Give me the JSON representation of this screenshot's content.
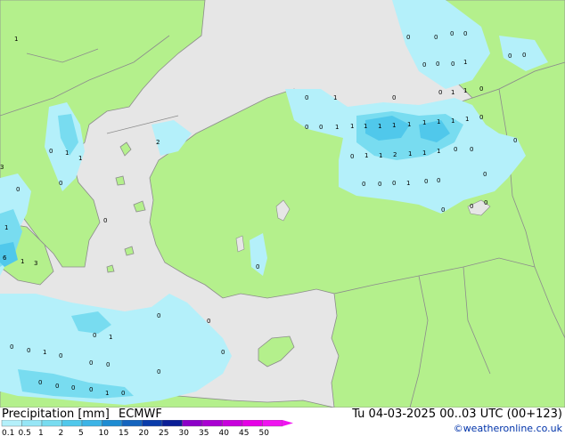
{
  "header": {
    "title": "Precipitation [mm]",
    "model": "ECMWF",
    "datetime": "Tu 04-03-2025 00..03 UTC (00+123)",
    "credit": "©weatheronline.co.uk"
  },
  "legend": {
    "ticks": [
      "0.1",
      "0.5",
      "1",
      "2",
      "5",
      "10",
      "15",
      "20",
      "25",
      "30",
      "35",
      "40",
      "45",
      "50"
    ],
    "colors": [
      "#b4f0fa",
      "#96e6f6",
      "#78dcf0",
      "#50c8eb",
      "#3cb4e6",
      "#1e8cd2",
      "#1464be",
      "#0a3caa",
      "#0a1e96",
      "#8c00c8",
      "#aa00d2",
      "#c800dc",
      "#e600e6",
      "#f014f0"
    ]
  },
  "map_colors": {
    "land": "#b4f08c",
    "sea": "#e6e6e6",
    "coast": "#8c8c8c",
    "border": "#8c8c8c",
    "precip_light": "#b4f0fa",
    "precip_mid": "#78dcf0",
    "precip_strong": "#50c8eb"
  },
  "station_values": [
    "0",
    "1",
    "2",
    "3",
    "6"
  ]
}
